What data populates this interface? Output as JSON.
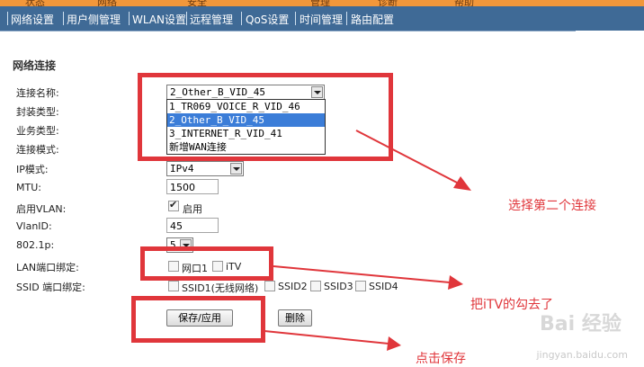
{
  "topnav_partial": [
    "状态",
    "网络",
    "安全",
    "管理",
    "诊断",
    "帮助"
  ],
  "navbar": {
    "items": [
      "网络设置",
      "用户侧管理",
      "WLAN设置",
      "远程管理",
      "QoS设置",
      "时间管理",
      "路由配置"
    ]
  },
  "section": {
    "title": "网络连接"
  },
  "form": {
    "conn_name_label": "连接名称:",
    "encap_label": "封装类型:",
    "service_label": "业务类型:",
    "conn_mode_label": "连接模式:",
    "ip_mode_label": "IP模式:",
    "mtu_label": "MTU:",
    "enable_vlan_label": "启用VLAN:",
    "vlanid_label": "VlanID:",
    "dot1p_label": "802.1p:",
    "lan_bind_label": "LAN端口绑定:",
    "ssid_bind_label": "SSID 端口绑定:",
    "conn_name_value": "2_Other_B_VID_45",
    "conn_options": [
      "1_TR069_VOICE_R_VID_46",
      "2_Other_B_VID_45",
      "3_INTERNET_R_VID_41",
      "新增WAN连接"
    ],
    "conn_selected_index": 1,
    "ip_mode_value": "IPv4",
    "mtu_value": "1500",
    "enable_vlan_text": "启用",
    "vlanid_value": "45",
    "dot1p_value": "5",
    "lan_ports": [
      "网口1",
      "iTV"
    ],
    "ssids": [
      "SSID1(无线网络)",
      "SSID2",
      "SSID3",
      "SSID4"
    ]
  },
  "buttons": {
    "save": "保存/应用",
    "delete": "删除"
  },
  "annotations": {
    "select_second": "选择第二个连接",
    "uncheck_itv": "把iTV的勾去了",
    "click_save": "点击保存"
  },
  "watermark": {
    "logo": "Bai 经验",
    "url": "jingyan.baidu.com"
  },
  "colors": {
    "navbar": "#3f6a96",
    "topbar": "#f2973a",
    "annotation": "#e0363b",
    "selection": "#3b7dd8"
  }
}
